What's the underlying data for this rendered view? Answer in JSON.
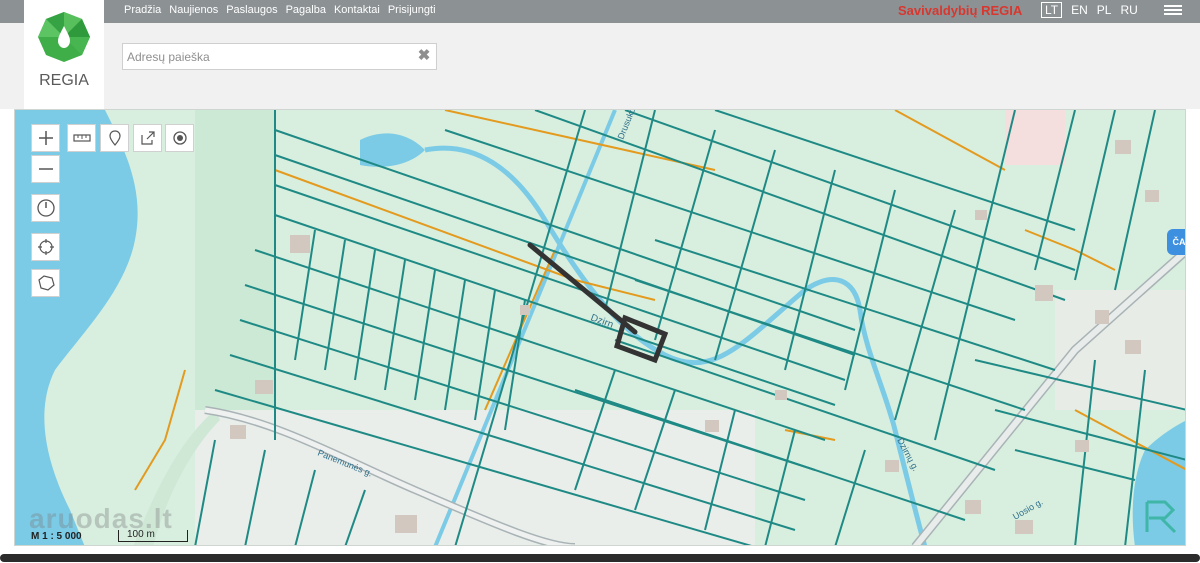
{
  "nav": [
    "Pradžia",
    "Naujienos",
    "Paslaugos",
    "Pagalba",
    "Kontaktai",
    "Prisijungti"
  ],
  "brand_title": "Savivaldybių REGIA",
  "languages": [
    "LT",
    "EN",
    "PL",
    "RU"
  ],
  "active_language": "LT",
  "logo_text": "REGIA",
  "search": {
    "placeholder": "Adresų paieška",
    "value": ""
  },
  "map": {
    "street_labels": [
      "Drusuko g.",
      "Dzirn",
      "Panemunės g.",
      "Dzirnų g.",
      "Uosio g."
    ],
    "scale_text": "M 1 : 5 000",
    "scale_bar_label": "100 m",
    "watermark": "aruodas.lt",
    "colors": {
      "land": "#d8efdf",
      "water": "#7ccbe6",
      "parcel_line": "#1f8a85",
      "road_orange": "#e39a1e",
      "road_gray": "#a9b3b6",
      "building": "#d3c8c0",
      "marker": "#333333"
    }
  },
  "tools": [
    "zoom-in-icon",
    "zoom-out-icon",
    "measure-icon",
    "pin-icon",
    "share-icon",
    "locate-icon",
    "history-icon",
    "crosshair-icon",
    "polygon-icon"
  ],
  "side_button": "ČA"
}
